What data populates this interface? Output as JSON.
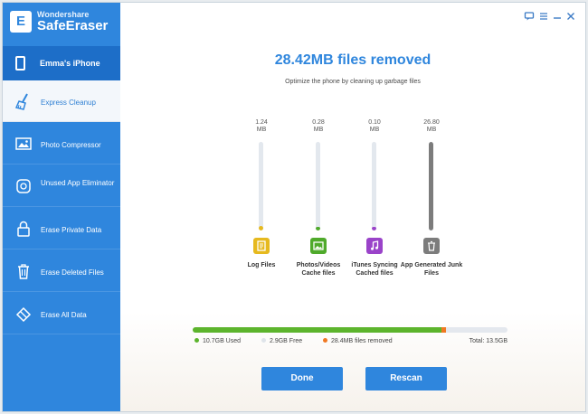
{
  "app": {
    "brand_small": "Wondershare",
    "brand_big": "SafeEraser",
    "logo_letter": "E"
  },
  "sidebar": {
    "device_label": "Emma's iPhone",
    "items": [
      {
        "label": "Express Cleanup",
        "icon": "broom-icon",
        "active": true
      },
      {
        "label": "Photo Compressor",
        "icon": "image-icon",
        "active": false
      },
      {
        "label": "Unused App Eliminator",
        "icon": "app-icon",
        "active": false
      },
      {
        "label": "Erase Private Data",
        "icon": "lock-icon",
        "active": false
      },
      {
        "label": "Erase Deleted Files",
        "icon": "trash-icon",
        "active": false
      },
      {
        "label": "Erase All Data",
        "icon": "eraser-icon",
        "active": false
      }
    ]
  },
  "window_controls": {
    "feedback": "feedback-icon",
    "menu": "menu-icon",
    "minimize": "minimize-icon",
    "close": "close-icon"
  },
  "main": {
    "headline": "28.42MB files removed",
    "subline": "Optimize the phone by cleaning up garbage files",
    "categories": [
      {
        "size": "1.24",
        "unit": "MB",
        "label": "Log Files",
        "icon": "log-icon",
        "color": "#e6b91e",
        "fill_fraction": 0.05
      },
      {
        "size": "0.28",
        "unit": "MB",
        "label": "Photos/Videos Cache files",
        "icon": "photo-icon",
        "color": "#4faa2b",
        "fill_fraction": 0.03
      },
      {
        "size": "0.10",
        "unit": "MB",
        "label": "iTunes Syncing Cached files",
        "icon": "music-icon",
        "color": "#9a43c9",
        "fill_fraction": 0.03
      },
      {
        "size": "26.80",
        "unit": "MB",
        "label": "App Generated Junk Files",
        "icon": "trash-icon",
        "color": "#7c7c7c",
        "fill_fraction": 1.0
      }
    ],
    "storage": {
      "used_label": "10.7GB Used",
      "free_label": "2.9GB Free",
      "removed_label": "28.4MB files removed",
      "total_label": "Total: 13.5GB",
      "used_fraction": 0.79,
      "removed_fraction": 0.015,
      "used_color": "#5cb42c",
      "free_color": "#e4e8ee",
      "removed_color": "#f07822"
    },
    "buttons": {
      "done": "Done",
      "rescan": "Rescan"
    }
  }
}
